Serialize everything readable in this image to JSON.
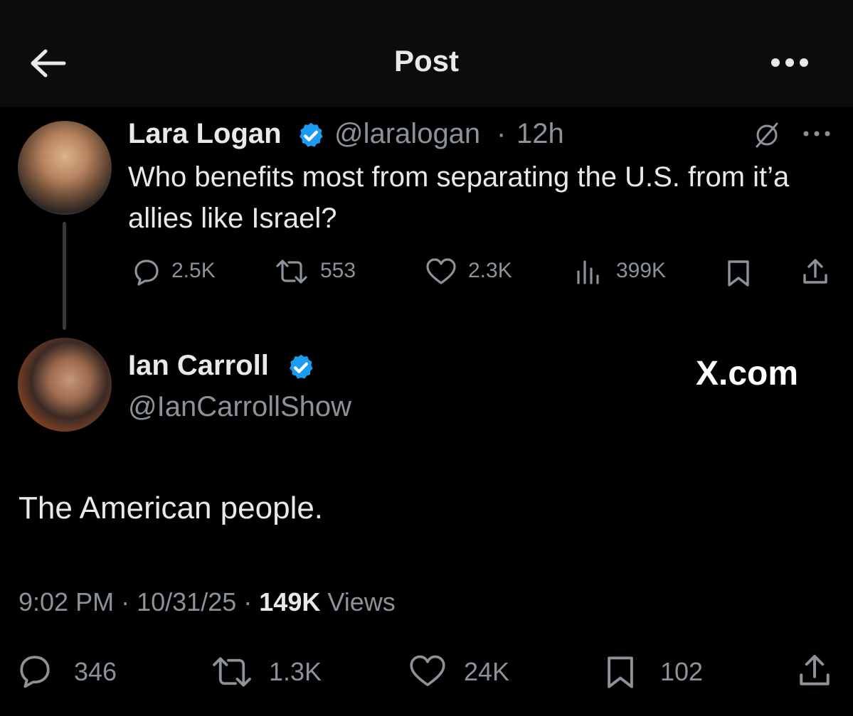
{
  "header": {
    "title": "Post"
  },
  "quoted_tweet": {
    "author_name": "Lara Logan",
    "handle": "@laralogan",
    "time": "12h",
    "separator": "·",
    "text": "Who benefits most from separating the U.S. from it’a allies like Israel?",
    "replies": "2.5K",
    "reposts": "553",
    "likes": "2.3K",
    "views": "399K"
  },
  "reply": {
    "author_name": "Ian Carroll",
    "handle": "@IanCarrollShow",
    "watermark": "X.com",
    "text": "The American people.",
    "time": "9:02 PM",
    "date": "10/31/25",
    "views_count": "149K",
    "views_label": "Views",
    "separator": "·",
    "replies": "346",
    "reposts": "1.3K",
    "likes": "24K",
    "bookmarks": "102"
  },
  "colors": {
    "background": "#000000",
    "verified": "#1d9bf0",
    "muted": "#8b9299",
    "text": "#e7e9ea"
  }
}
